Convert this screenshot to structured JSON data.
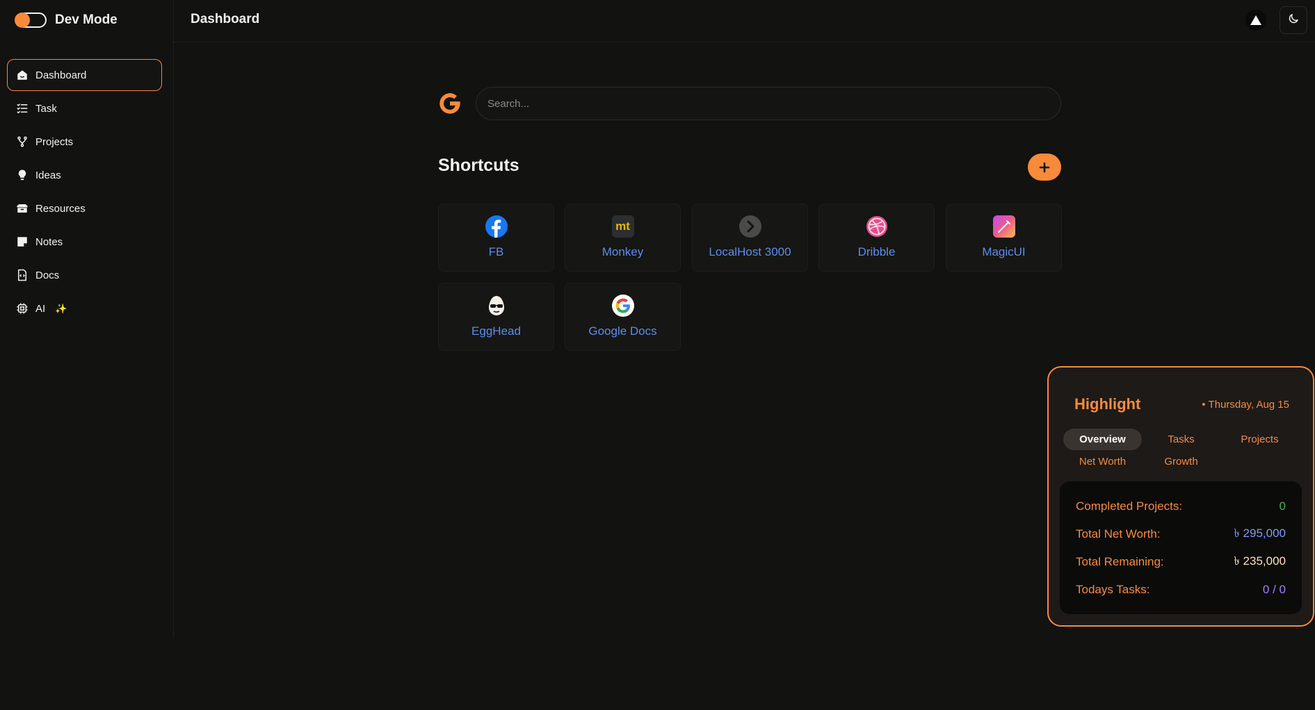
{
  "app": {
    "brand": "Dev Mode",
    "page_title": "Dashboard"
  },
  "sidebar": {
    "items": [
      {
        "label": "Dashboard",
        "icon": "home-icon",
        "active": true
      },
      {
        "label": "Task",
        "icon": "task-list-icon"
      },
      {
        "label": "Projects",
        "icon": "fork-icon"
      },
      {
        "label": "Ideas",
        "icon": "lightbulb-icon"
      },
      {
        "label": "Resources",
        "icon": "box-icon"
      },
      {
        "label": "Notes",
        "icon": "note-icon"
      },
      {
        "label": "Docs",
        "icon": "doc-code-icon"
      },
      {
        "label": "AI",
        "icon": "chip-icon",
        "suffix": "✨"
      }
    ]
  },
  "header": {
    "buttons": [
      "triangle-icon",
      "moon-icon"
    ]
  },
  "search": {
    "placeholder": "Search...",
    "value": ""
  },
  "shortcuts": {
    "title": "Shortcuts",
    "add_label": "+",
    "items": [
      {
        "label": "FB",
        "icon": "facebook-icon"
      },
      {
        "label": "Monkey",
        "icon": "monkeytype-icon",
        "icon_text": "mt"
      },
      {
        "label": "LocalHost 3000",
        "icon": "chevron-right-icon"
      },
      {
        "label": "Dribble",
        "icon": "dribbble-icon"
      },
      {
        "label": "MagicUI",
        "icon": "magicui-icon"
      },
      {
        "label": "EggHead",
        "icon": "egghead-icon"
      },
      {
        "label": "Google Docs",
        "icon": "google-icon"
      }
    ]
  },
  "highlight": {
    "title": "Highlight",
    "date": "Thursday, Aug 15",
    "tabs": [
      {
        "label": "Overview",
        "active": true
      },
      {
        "label": "Tasks"
      },
      {
        "label": "Projects"
      },
      {
        "label": "Net Worth"
      },
      {
        "label": "Growth"
      }
    ],
    "stats": [
      {
        "label": "Completed Projects:",
        "value": "0",
        "color": "#4caf50"
      },
      {
        "label": "Total Net Worth:",
        "value": "৳ 295,000",
        "color": "#7c9cf5"
      },
      {
        "label": "Total Remaining:",
        "value": "৳ 235,000",
        "color": "#ffe3b0"
      },
      {
        "label": "Todays Tasks:",
        "value": "0 / 0",
        "color": "#a97cf5"
      }
    ]
  },
  "colors": {
    "accent": "#f78b3a",
    "background": "#121210",
    "link": "#5b8def"
  }
}
